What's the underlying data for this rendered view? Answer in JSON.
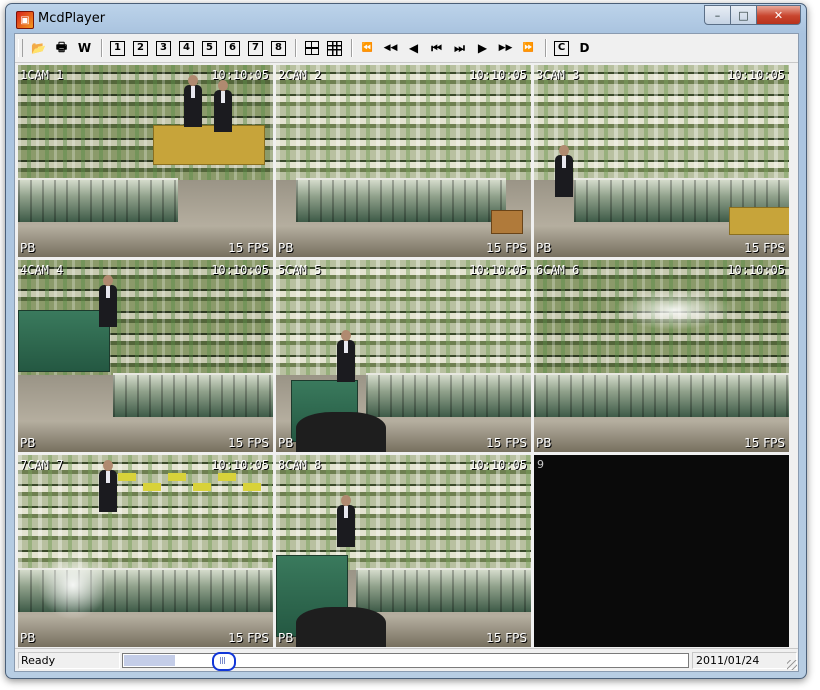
{
  "window": {
    "title": "McdPlayer",
    "minimize_glyph": "–",
    "maximize_glyph": "□",
    "close_glyph": "✕"
  },
  "toolbar": {
    "items": [
      {
        "name": "open-icon",
        "glyph": "📂"
      },
      {
        "name": "print-icon",
        "glyph": "🖶"
      },
      {
        "name": "w-button",
        "glyph": "W"
      },
      {
        "name": "layout-1-button",
        "glyph": "1"
      },
      {
        "name": "layout-2-button",
        "glyph": "2"
      },
      {
        "name": "layout-3-button",
        "glyph": "3"
      },
      {
        "name": "layout-4-button",
        "glyph": "4"
      },
      {
        "name": "layout-5-button",
        "glyph": "5"
      },
      {
        "name": "layout-6-button",
        "glyph": "6"
      },
      {
        "name": "layout-7-button",
        "glyph": "7"
      },
      {
        "name": "layout-8-button",
        "glyph": "8"
      },
      {
        "name": "grid-2x2-button",
        "glyph": ""
      },
      {
        "name": "grid-3x3-button",
        "glyph": ""
      },
      {
        "name": "fast-rewind-button",
        "glyph": "⏪"
      },
      {
        "name": "rewind-button",
        "glyph": "◀◀"
      },
      {
        "name": "step-back-button",
        "glyph": "◀"
      },
      {
        "name": "skip-start-button",
        "glyph": "⏮"
      },
      {
        "name": "skip-end-button",
        "glyph": "⏭"
      },
      {
        "name": "play-button",
        "glyph": "▶"
      },
      {
        "name": "fast-forward-button",
        "glyph": "▶▶"
      },
      {
        "name": "fastest-forward-button",
        "glyph": "⏩"
      },
      {
        "name": "capture-button",
        "glyph": "C"
      },
      {
        "name": "d-button",
        "glyph": "D"
      }
    ]
  },
  "cameras": [
    {
      "label": "1CAM 1",
      "time": "10:10:05",
      "mode": "PB",
      "fps": "15 FPS"
    },
    {
      "label": "2CAM 2",
      "time": "10:10:05",
      "mode": "PB",
      "fps": "15 FPS"
    },
    {
      "label": "3CAM 3",
      "time": "10:10:05",
      "mode": "PB",
      "fps": "15 FPS"
    },
    {
      "label": "4CAM 4",
      "time": "10:10:05",
      "mode": "PB",
      "fps": "15 FPS"
    },
    {
      "label": "5CAM 5",
      "time": "10:10:05",
      "mode": "PB",
      "fps": "15 FPS"
    },
    {
      "label": "6CAM 6",
      "time": "10:10:05",
      "mode": "PB",
      "fps": "15 FPS"
    },
    {
      "label": "7CAM 7",
      "time": "10:10:05",
      "mode": "PB",
      "fps": "15 FPS"
    },
    {
      "label": "8CAM 8",
      "time": "10:10:05",
      "mode": "PB",
      "fps": "15 FPS"
    }
  ],
  "empty_slot": {
    "label": "9"
  },
  "status": {
    "text": "Ready",
    "date": "2011/01/24",
    "timeline_position_fraction": 0.09
  }
}
